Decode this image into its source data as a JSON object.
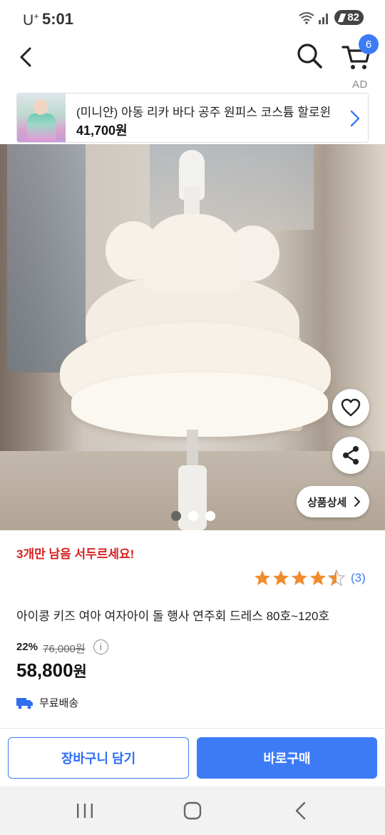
{
  "status_bar": {
    "carrier": "U",
    "carrier_sup": "+",
    "time": "5:01",
    "battery": "82",
    "icons": [
      "wifi-icon",
      "signal-icon",
      "battery-icon"
    ]
  },
  "nav": {
    "icons": [
      "back-arrow-icon",
      "search-icon",
      "cart-icon"
    ],
    "cart_count": "6"
  },
  "ad": {
    "tag": "AD",
    "title": "(미니얀) 아동 리카 바다 공주 원피스 코스튬 할로윈",
    "price": "41,700원"
  },
  "gallery": {
    "detail_button": "상품상세",
    "dot_count": 3,
    "active_index": 0,
    "icons": [
      "heart-icon",
      "share-icon"
    ]
  },
  "product": {
    "urgency": "3개만 남음 서두르세요!",
    "rating": 4.5,
    "review_count": "(3)",
    "title": "아이콩 키즈 여아 여자아이 돌 행사 연주회 드레스 80호~120호",
    "discount": "22%",
    "original_price": "76,000원",
    "price_number": "58,800",
    "price_unit": "원",
    "shipping": "무료배송"
  },
  "actions": {
    "add_to_cart": "장바구니 담기",
    "buy_now": "바로구매"
  },
  "colors": {
    "accent": "#3d7bf6",
    "urgent": "#d71f1f",
    "star": "#f08c2e"
  }
}
